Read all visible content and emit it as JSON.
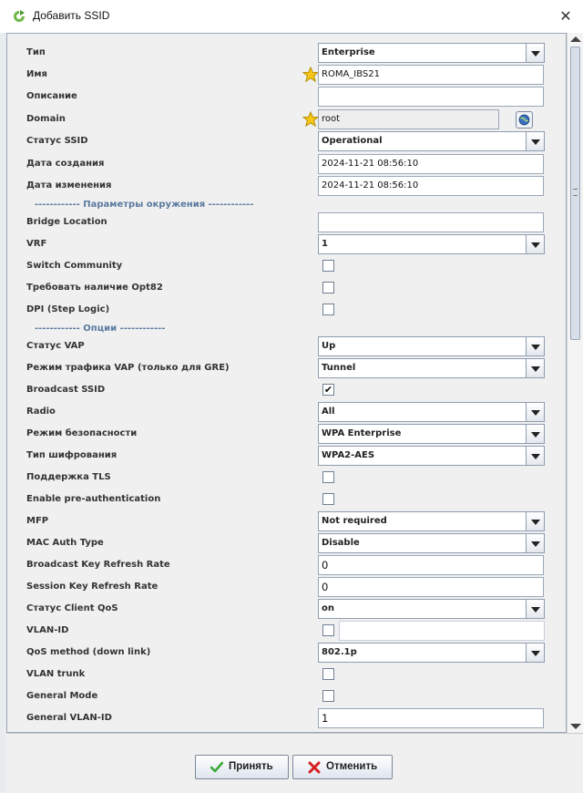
{
  "window": {
    "title": "Добавить SSID"
  },
  "fields": {
    "type": {
      "label": "Тип",
      "value": "Enterprise"
    },
    "name": {
      "label": "Имя",
      "value": "ROMA_IBS21"
    },
    "description": {
      "label": "Описание",
      "value": ""
    },
    "domain": {
      "label": "Domain",
      "value": "root"
    },
    "ssid_status": {
      "label": "Статус SSID",
      "value": "Operational"
    },
    "created": {
      "label": "Дата создания",
      "value": "2024-11-21 08:56:10"
    },
    "modified": {
      "label": "Дата изменения",
      "value": "2024-11-21 08:56:10"
    }
  },
  "section_env": "------------ Параметры окружения ------------",
  "env": {
    "bridge_location": {
      "label": "Bridge Location",
      "value": ""
    },
    "vrf": {
      "label": "VRF",
      "value": "1"
    },
    "switch_community": {
      "label": "Switch Community",
      "checked": false
    },
    "opt82": {
      "label": "Требовать наличие Opt82",
      "checked": false
    },
    "dpi": {
      "label": "DPI (Step Logic)",
      "checked": false
    }
  },
  "section_options": "------------ Опции ------------",
  "options": {
    "vap_status": {
      "label": "Статус VAP",
      "value": "Up"
    },
    "vap_traffic": {
      "label": "Режим трафика VAP (только для GRE)",
      "value": "Tunnel"
    },
    "broadcast_ssid": {
      "label": "Broadcast SSID",
      "checked": true,
      "mark": "✔"
    },
    "radio": {
      "label": "Radio",
      "value": "All"
    },
    "security_mode": {
      "label": "Режим безопасности",
      "value": "WPA Enterprise"
    },
    "encryption": {
      "label": "Тип шифрования",
      "value": "WPA2-AES"
    },
    "tls": {
      "label": "Поддержка TLS",
      "checked": false
    },
    "preauth": {
      "label": "Enable pre-authentication",
      "checked": false
    },
    "mfp": {
      "label": "MFP",
      "value": "Not required"
    },
    "mac_auth": {
      "label": "MAC Auth Type",
      "value": "Disable"
    },
    "bcast_key_refresh": {
      "label": "Broadcast Key Refresh Rate",
      "value": "0"
    },
    "session_key_refresh": {
      "label": "Session Key Refresh Rate",
      "value": "0"
    },
    "client_qos": {
      "label": "Статус Client QoS",
      "value": "on"
    },
    "vlan_id": {
      "label": "VLAN-ID",
      "checked": false,
      "value": ""
    },
    "qos_method": {
      "label": "QoS method (down link)",
      "value": "802.1p"
    },
    "vlan_trunk": {
      "label": "VLAN trunk",
      "checked": false
    },
    "general_mode": {
      "label": "General Mode",
      "checked": false
    },
    "general_vlan_id": {
      "label": "General VLAN-ID",
      "value": "1"
    }
  },
  "buttons": {
    "ok": "Принять",
    "cancel": "Отменить"
  },
  "colors": {
    "accent": "#5a7aa0",
    "ok": "#3aa83a",
    "cancel": "#d62020"
  }
}
